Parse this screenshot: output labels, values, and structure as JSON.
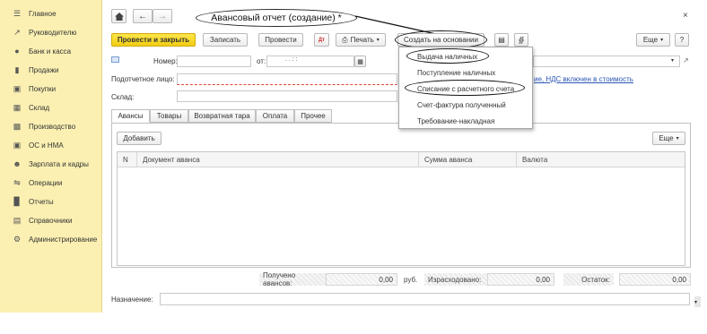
{
  "sidebar": {
    "items": [
      {
        "label": "Главное",
        "icon": "menu-lines-icon"
      },
      {
        "label": "Руководителю",
        "icon": "trend-chart-icon"
      },
      {
        "label": "Банк и касса",
        "icon": "coin-icon"
      },
      {
        "label": "Продажи",
        "icon": "shopping-bag-icon"
      },
      {
        "label": "Покупки",
        "icon": "cart-icon"
      },
      {
        "label": "Склад",
        "icon": "warehouse-grid-icon"
      },
      {
        "label": "Производство",
        "icon": "factory-icon"
      },
      {
        "label": "ОС и НМА",
        "icon": "building-icon"
      },
      {
        "label": "Зарплата и кадры",
        "icon": "person-icon"
      },
      {
        "label": "Операции",
        "icon": "operations-icon"
      },
      {
        "label": "Отчеты",
        "icon": "bar-chart-icon"
      },
      {
        "label": "Справочники",
        "icon": "book-icon"
      },
      {
        "label": "Администрирование",
        "icon": "gear-icon"
      }
    ]
  },
  "header": {
    "title": "Авансовый отчет (создание) *",
    "close": "×"
  },
  "toolbar": {
    "post_close": "Провести и закрыть",
    "save": "Записать",
    "post": "Провести",
    "print": "Печать",
    "create_basis": "Создать на основании",
    "more": "Еще",
    "help": "?"
  },
  "form": {
    "number_label": "Номер:",
    "number_value": "",
    "date_label": "от:",
    "date_value": ". .   : :",
    "person_label": "Подотчетное лицо:",
    "warehouse_label": "Склад:",
    "vat_link": "ие, НДС включен в стоимость"
  },
  "tabs": [
    {
      "label": "Авансы"
    },
    {
      "label": "Товары"
    },
    {
      "label": "Возвратная тара"
    },
    {
      "label": "Оплата"
    },
    {
      "label": "Прочее"
    }
  ],
  "panel": {
    "add_button": "Добавить",
    "more": "Еще"
  },
  "grid": {
    "columns": [
      "N",
      "Документ аванса",
      "Сумма аванса",
      "Валюта"
    ]
  },
  "totals": {
    "received_label": "Получено авансов:",
    "received_value": "0,00",
    "currency": "руб.",
    "spent_label": "Израсходовано:",
    "spent_value": "0,00",
    "balance_label": "Остаток:",
    "balance_value": "0,00"
  },
  "purpose_label": "Назначение:",
  "dropdown": {
    "items": [
      "Выдача наличных",
      "Поступление наличных",
      "Списание с расчетного счета",
      "Счет-фактура полученный",
      "Требование-накладная"
    ]
  }
}
